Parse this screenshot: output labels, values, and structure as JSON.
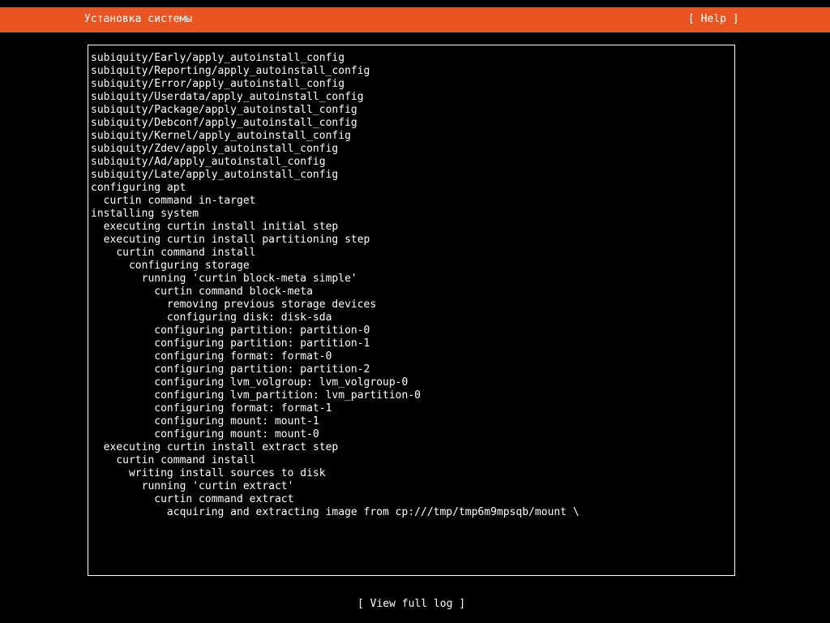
{
  "header": {
    "title": "Установка системы",
    "help_label": "[ Help ]",
    "background_color": "#e95420"
  },
  "log": {
    "lines": [
      "subiquity/Early/apply_autoinstall_config",
      "subiquity/Reporting/apply_autoinstall_config",
      "subiquity/Error/apply_autoinstall_config",
      "subiquity/Userdata/apply_autoinstall_config",
      "subiquity/Package/apply_autoinstall_config",
      "subiquity/Debconf/apply_autoinstall_config",
      "subiquity/Kernel/apply_autoinstall_config",
      "subiquity/Zdev/apply_autoinstall_config",
      "subiquity/Ad/apply_autoinstall_config",
      "subiquity/Late/apply_autoinstall_config",
      "configuring apt",
      "  curtin command in-target",
      "installing system",
      "  executing curtin install initial step",
      "  executing curtin install partitioning step",
      "    curtin command install",
      "      configuring storage",
      "        running 'curtin block-meta simple'",
      "          curtin command block-meta",
      "            removing previous storage devices",
      "            configuring disk: disk-sda",
      "          configuring partition: partition-0",
      "          configuring partition: partition-1",
      "          configuring format: format-0",
      "          configuring partition: partition-2",
      "          configuring lvm_volgroup: lvm_volgroup-0",
      "          configuring lvm_partition: lvm_partition-0",
      "          configuring format: format-1",
      "          configuring mount: mount-1",
      "          configuring mount: mount-0",
      "  executing curtin install extract step",
      "    curtin command install",
      "      writing install sources to disk",
      "        running 'curtin extract'",
      "          curtin command extract",
      "            acquiring and extracting image from cp:///tmp/tmp6m9mpsqb/mount \\"
    ]
  },
  "footer": {
    "view_log_label": "[ View full log ]"
  }
}
